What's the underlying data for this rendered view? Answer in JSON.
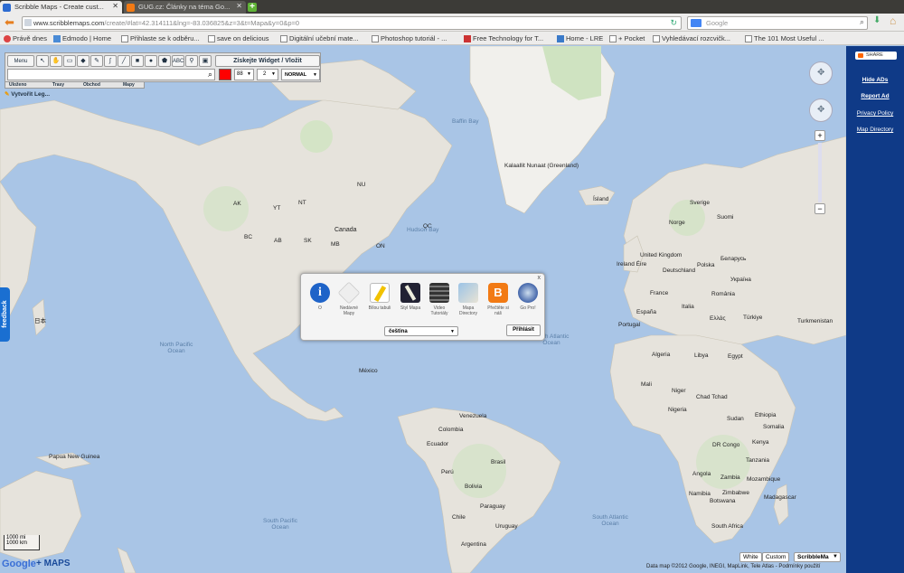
{
  "browser": {
    "tabs": [
      {
        "title": "Scribble Maps - Create cust...",
        "active": true
      },
      {
        "title": "GUG.cz: Články na téma Go...",
        "active": false
      }
    ],
    "url_domain": "www.scribblemaps.com",
    "url_rest": "/create/#lat=42.314111&lng=-83.036825&z=3&t=Mapa&y=0&p=0",
    "search_placeholder": "Google",
    "bookmarks": [
      "Právě dnes",
      "Edmodo | Home",
      "Přihlaste se k odběru...",
      "save on delicious",
      "Digitální učební mate...",
      "Photoshop tutoriál - ...",
      "Free Technology for T...",
      "Home - LRE",
      "+ Pocket",
      "Vyhledávací rozcvičk...",
      "The 101 Most Useful ..."
    ]
  },
  "toolbar": {
    "menu_label": "Menu",
    "widget_label": "Získejte Widget / Vložit",
    "font_size": "88",
    "line_width": "2",
    "blend_mode": "NORMAL",
    "tabs": [
      "Uloženo",
      "Trasy",
      "Obchod",
      "Mapy"
    ],
    "legend_label": "Vytvořit Leg...",
    "text_tool_label": "ABC",
    "color": "#ff0000"
  },
  "sidebar": {
    "share": "SHARE",
    "links": [
      "Hide ADs",
      "Report Ad",
      "Privacy Policy",
      "Map Directory"
    ]
  },
  "dialog": {
    "items": [
      "O",
      "Nedávné Mapy",
      "Bílou tabuli",
      "Styl Mapa",
      "Video Tutoriály",
      "Mapa Directory",
      "Přečtěte si náš",
      "Go Pro!"
    ],
    "language": "čeština",
    "login": "Přihlásit",
    "close": "x"
  },
  "feedback": "feedback",
  "map": {
    "labels": [
      "Kalaallit Nunaat (Greenland)",
      "Ísland",
      "Canada",
      "AK",
      "YT",
      "NT",
      "NU",
      "BC",
      "AB",
      "SK",
      "MB",
      "ON",
      "QC",
      "México",
      "Venezuela",
      "Colombia",
      "Ecuador",
      "Perú",
      "Brasil",
      "Bolivia",
      "Paraguay",
      "Chile",
      "Argentina",
      "Uruguay",
      "Sverige",
      "Suomi",
      "Norge",
      "United Kingdom",
      "Ireland Éire",
      "Deutschland",
      "Polska",
      "Беларусь",
      "Україна",
      "France",
      "España",
      "Portugal",
      "Italia",
      "Türkiye",
      "România",
      "Ελλάς",
      "Algeria",
      "Libya",
      "Egypt",
      "Mali",
      "Niger",
      "Chad Tchad",
      "Sudan",
      "Ethiopia",
      "Nigeria",
      "DR Congo",
      "Kenya",
      "Tanzania",
      "Angola",
      "Zambia",
      "Namibia",
      "Botswana",
      "Zimbabwe",
      "Mozambique",
      "South Africa",
      "Madagascar",
      "Somalia",
      "Turkmenistan",
      "Papua New Guinea",
      "日本",
      "Hudson Bay",
      "Baffin Bay"
    ],
    "oceans": [
      "North Pacific Ocean",
      "North Atlantic Ocean",
      "South Pacific Ocean",
      "South Atlantic Ocean"
    ],
    "scale": [
      "1000 mi",
      "1000 km"
    ],
    "map_types": [
      "White",
      "Custom",
      "ScribbleMa"
    ],
    "attribution": "Data map ©2012 Google, INEGI, MapLink, Tele Atlas - Podmínky použití"
  }
}
